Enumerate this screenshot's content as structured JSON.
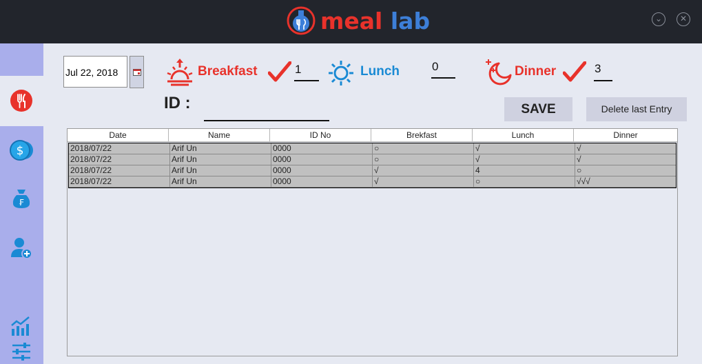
{
  "app": {
    "logo_meal": "meal",
    "logo_lab": "lab"
  },
  "window": {
    "minimize_glyph": "⌄",
    "close_glyph": "✕"
  },
  "sidebar": {
    "items": [
      {
        "name": "meals",
        "icon": "fork-knife-icon"
      },
      {
        "name": "payments",
        "icon": "coins-icon"
      },
      {
        "name": "funds",
        "icon": "money-bag-icon"
      },
      {
        "name": "add-member",
        "icon": "add-user-icon"
      },
      {
        "name": "statistics",
        "icon": "chart-icon"
      },
      {
        "name": "settings",
        "icon": "sliders-icon"
      }
    ]
  },
  "date_picker": {
    "value": "Jul 22, 2018"
  },
  "meals": {
    "breakfast": {
      "label": "Breakfast",
      "count": "1",
      "checked": true
    },
    "lunch": {
      "label": "Lunch",
      "count": "0",
      "checked": false
    },
    "dinner": {
      "label": "Dinner",
      "count": "3",
      "checked": true
    }
  },
  "id_field": {
    "label": "ID :",
    "value": ""
  },
  "buttons": {
    "save": "SAVE",
    "delete_last": "Delete last Entry"
  },
  "table": {
    "columns": [
      "Date",
      "Name",
      "ID No",
      "Brekfast",
      "Lunch",
      "Dinner"
    ],
    "rows": [
      [
        "2018/07/22",
        "Arif Un",
        "0000",
        "○",
        "√",
        "√"
      ],
      [
        "2018/07/22",
        "Arif Un",
        "0000",
        "○",
        "√",
        "√"
      ],
      [
        "2018/07/22",
        "Arif Un",
        "0000",
        "√",
        "4",
        "○"
      ],
      [
        "2018/07/22",
        "Arif Un",
        "0000",
        "√",
        "○",
        "√√√"
      ]
    ]
  },
  "colors": {
    "accent_red": "#e8322b",
    "accent_blue": "#1a8ad4",
    "sidebar": "#a9aeeb",
    "titlebar": "#22252c"
  }
}
